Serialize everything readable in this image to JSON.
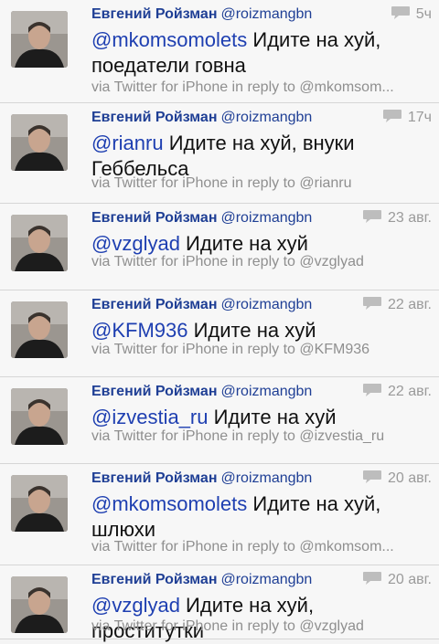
{
  "tweets": [
    {
      "name": "Евгений Ройзман",
      "handle": "@roizmangbn",
      "time": "5ч",
      "mention": "@mkomsomolets",
      "text": " Идите на хуй, поедатели говна",
      "via": "via Twitter for iPhone in reply to @mkomsom..."
    },
    {
      "name": "Евгений Ройзман",
      "handle": "@roizmangbn",
      "time": "17ч",
      "mention": "@rianru",
      "text": " Идите на хуй, внуки Геббельса",
      "via": "via Twitter for iPhone in reply to @rianru"
    },
    {
      "name": "Евгений Ройзман",
      "handle": "@roizmangbn",
      "time": "23 авг.",
      "mention": "@vzglyad",
      "text": " Идите на хуй",
      "via": "via Twitter for iPhone in reply to @vzglyad"
    },
    {
      "name": "Евгений Ройзман",
      "handle": "@roizmangbn",
      "time": "22 авг.",
      "mention": "@KFM936",
      "text": " Идите на хуй",
      "via": "via Twitter for iPhone in reply to @KFM936"
    },
    {
      "name": "Евгений Ройзман",
      "handle": "@roizmangbn",
      "time": "22 авг.",
      "mention": "@izvestia_ru",
      "text": " Идите на хуй",
      "via": "via Twitter for iPhone in reply to @izvestia_ru"
    },
    {
      "name": "Евгений Ройзман",
      "handle": "@roizmangbn",
      "time": "20 авг.",
      "mention": "@mkomsomolets",
      "text": " Идите на хуй, шлюхи",
      "via": "via Twitter for iPhone in reply to @mkomsom..."
    },
    {
      "name": "Евгений Ройзман",
      "handle": "@roizmangbn",
      "time": "20 авг.",
      "mention": "@vzglyad",
      "text": " Идите на хуй, проститутки",
      "via": "via Twitter for iPhone in reply to @vzglyad"
    }
  ],
  "colors": {
    "name": "#1f3f95",
    "mention": "#1e3fb1",
    "meta": "#9a9a9a"
  },
  "icons": {
    "reply": "speech-bubble-icon"
  }
}
